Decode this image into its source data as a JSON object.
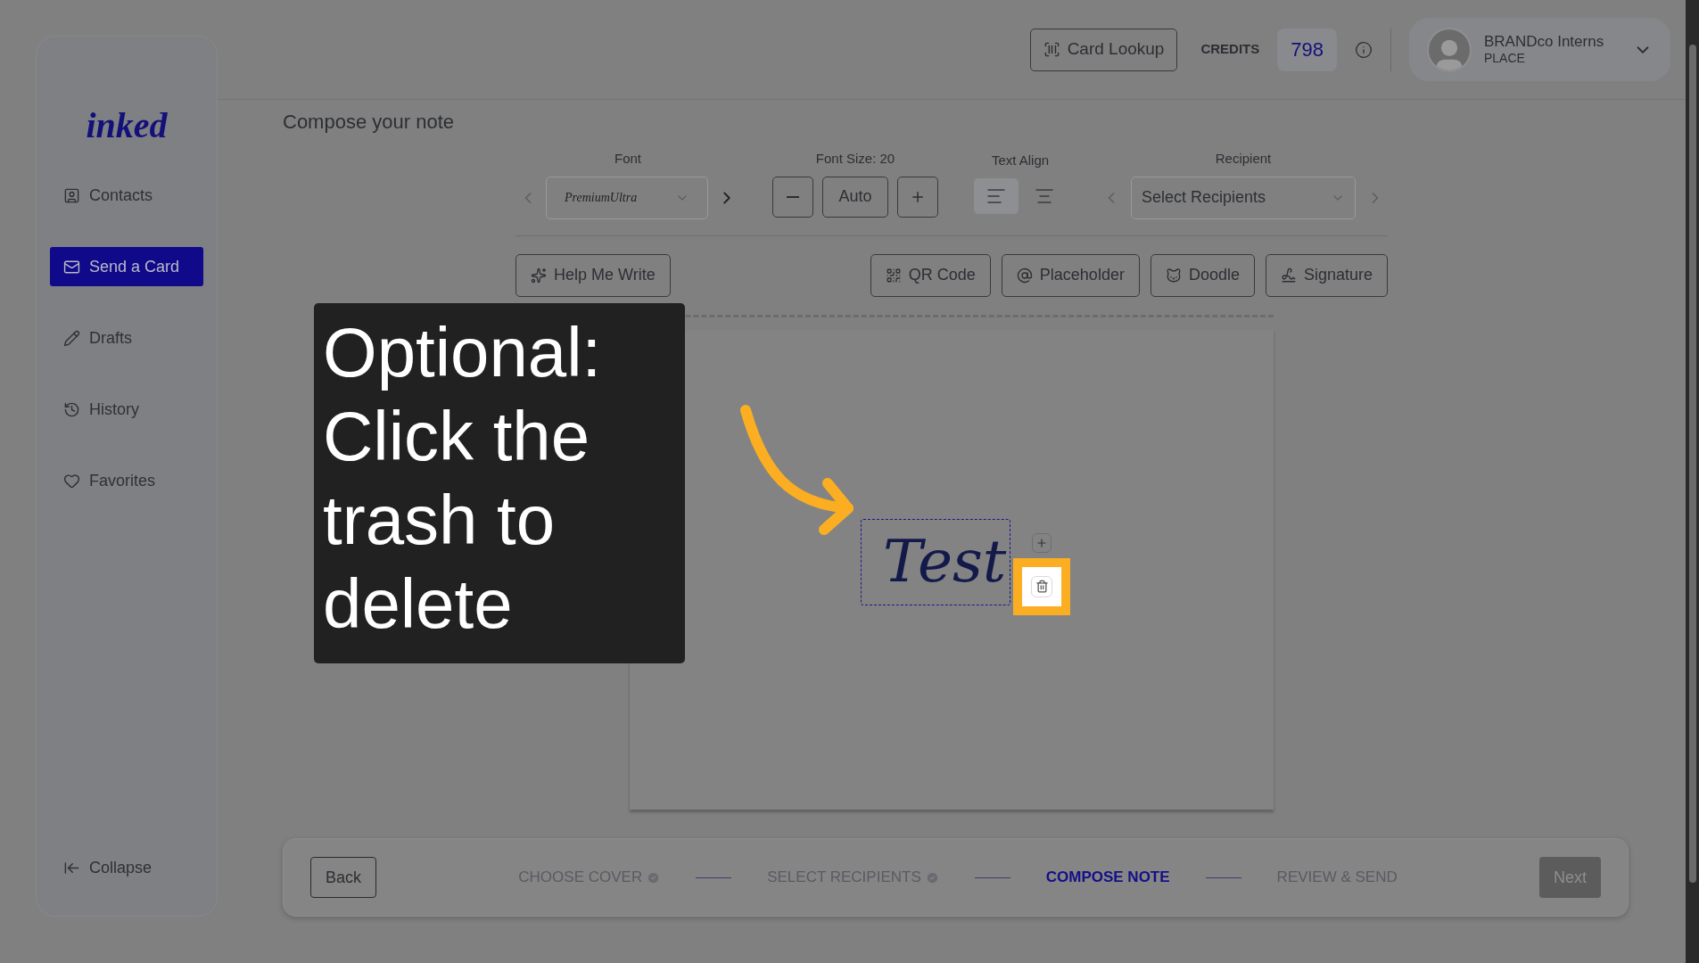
{
  "sidebar": {
    "logo": "inked",
    "items": [
      {
        "label": "Contacts",
        "selected": false
      },
      {
        "label": "Send a Card",
        "selected": true
      },
      {
        "label": "Drafts",
        "selected": false
      },
      {
        "label": "History",
        "selected": false
      },
      {
        "label": "Favorites",
        "selected": false
      }
    ],
    "collapse": "Collapse"
  },
  "header": {
    "card_lookup": "Card Lookup",
    "credits_label": "CREDITS",
    "credits": "798",
    "user": {
      "name": "BRANDco Interns",
      "role": "PLACE"
    }
  },
  "heading": "Compose your note",
  "toolbar": {
    "font": {
      "label": "Font",
      "value": "PremiumUltra"
    },
    "font_size": {
      "label": "Font Size: 20",
      "auto": "Auto"
    },
    "text_align": {
      "label": "Text Align",
      "options": [
        {
          "selected": true
        },
        {
          "selected": false
        }
      ]
    },
    "recipient": {
      "label": "Recipient",
      "value": "Select Recipients"
    }
  },
  "insert_buttons": [
    {
      "label": "Help Me Write"
    },
    {
      "label": "QR Code"
    },
    {
      "label": "Placeholder"
    },
    {
      "label": "Doodle"
    },
    {
      "label": "Signature"
    }
  ],
  "note": {
    "text": "Test"
  },
  "callout": {
    "text": "Optional: Click the trash to delete"
  },
  "steps": [
    {
      "label": "CHOOSE COVER",
      "completed": true,
      "selected": false
    },
    {
      "label": "SELECT RECIPIENTS",
      "completed": true,
      "selected": false
    },
    {
      "label": "COMPOSE NOTE",
      "completed": false,
      "selected": true
    },
    {
      "label": "REVIEW & SEND",
      "completed": false,
      "selected": false
    }
  ],
  "nav": {
    "back": "Back",
    "next": "Next",
    "next_disabled": true
  }
}
